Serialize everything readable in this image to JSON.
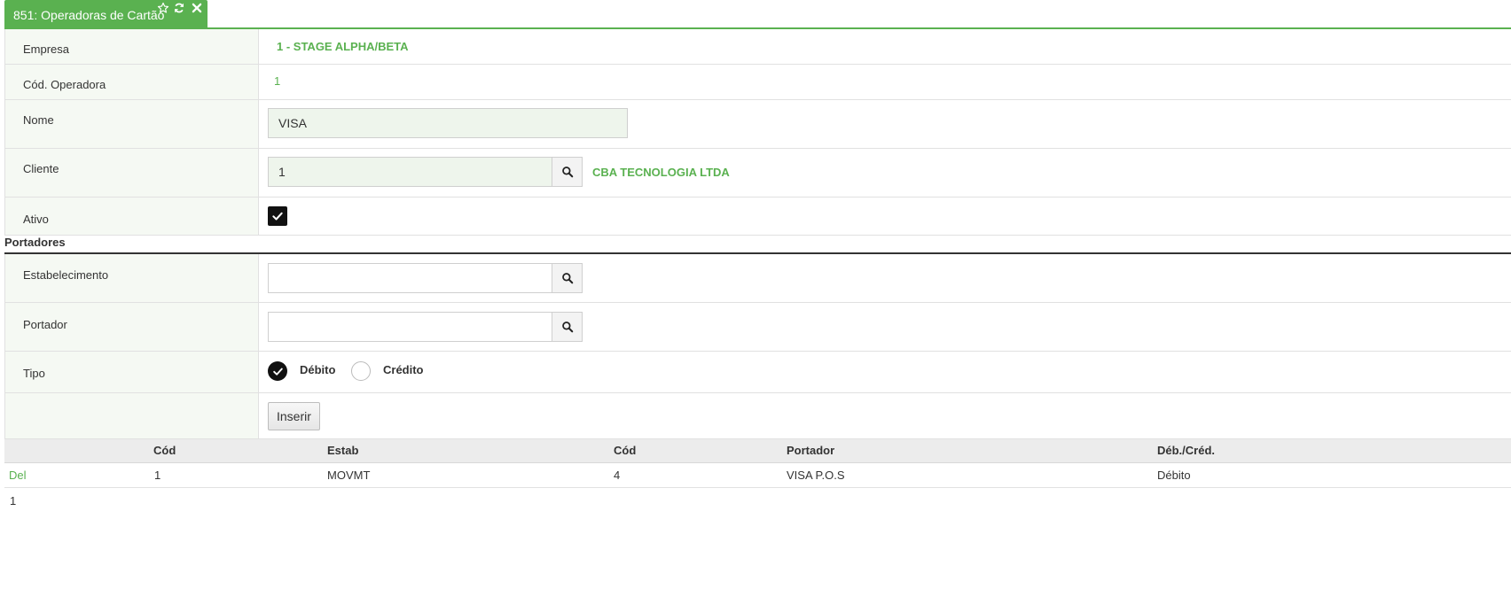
{
  "tab": {
    "title": "851: Operadoras de Cartão"
  },
  "form": {
    "empresa": {
      "label": "Empresa",
      "value": "1 - STAGE ALPHA/BETA"
    },
    "cod_operadora": {
      "label": "Cód. Operadora",
      "value": "1"
    },
    "nome": {
      "label": "Nome",
      "value": "VISA"
    },
    "cliente": {
      "label": "Cliente",
      "value": "1",
      "description": "CBA TECNOLOGIA LTDA"
    },
    "ativo": {
      "label": "Ativo",
      "checked": true
    }
  },
  "portadores": {
    "section_title": "Portadores",
    "estabelecimento": {
      "label": "Estabelecimento",
      "value": ""
    },
    "portador": {
      "label": "Portador",
      "value": ""
    },
    "tipo": {
      "label": "Tipo",
      "options": [
        "Débito",
        "Crédito"
      ],
      "selected": "Débito"
    },
    "insert_label": "Inserir"
  },
  "grid": {
    "headers": [
      "",
      "Cód",
      "Estab",
      "Cód",
      "Portador",
      "Déb./Créd."
    ],
    "rows": [
      {
        "action": "Del",
        "cod": "1",
        "estab": "MOVMT",
        "cod_portador": "4",
        "portador": "VISA P.O.S",
        "tipo": "Débito"
      }
    ],
    "page": "1"
  },
  "colors": {
    "accent": "#5ab150",
    "label_bg": "#f5f9f3"
  }
}
